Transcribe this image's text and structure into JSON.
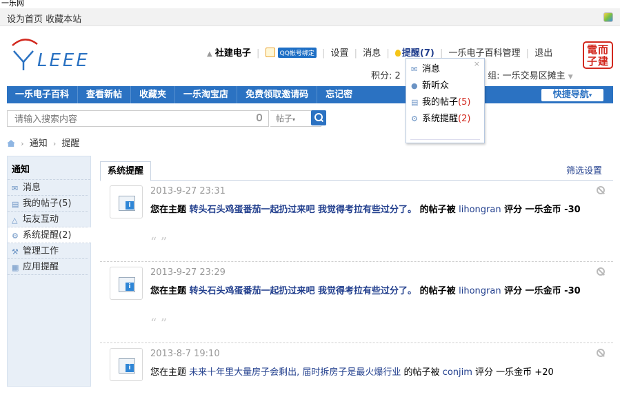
{
  "window": {
    "title": "一乐网"
  },
  "topbar": {
    "set_home": "设为首页",
    "bookmark": "收藏本站"
  },
  "user": {
    "name": "社建电子",
    "qq_bind": "QQ帐号绑定",
    "settings": "设置",
    "messages": "消息",
    "remind": "提醒(7)",
    "manage": "一乐电子百科管理",
    "logout": "退出",
    "score_label": "积分: 2",
    "group_label": "组: 一乐交易区摊主"
  },
  "seal": {
    "line1": "電而",
    "line2": "子建"
  },
  "nav": {
    "items": [
      "一乐电子百科",
      "查看新帖",
      "收藏夹",
      "一乐淘宝店",
      "免费领取邀请码",
      "忘记密"
    ],
    "quick": "快捷导航"
  },
  "search": {
    "placeholder": "请输入搜索内容",
    "type": "帖子"
  },
  "breadcrumb": {
    "items": [
      "通知",
      "提醒"
    ]
  },
  "sidebar": {
    "title": "通知",
    "items": [
      {
        "label": "消息",
        "icon": "envelope-icon"
      },
      {
        "label": "我的帖子(5)",
        "icon": "document-icon"
      },
      {
        "label": "坛友互动",
        "icon": "triangle-icon"
      },
      {
        "label": "系统提醒(2)",
        "icon": "gear-icon"
      },
      {
        "label": "管理工作",
        "icon": "wrench-icon"
      },
      {
        "label": "应用提醒",
        "icon": "grid-icon"
      }
    ]
  },
  "main": {
    "tab": "系统提醒",
    "filter": "筛选设置",
    "notices": [
      {
        "time": "2013-9-27 23:31",
        "prefix": "您在主题 ",
        "topic": "转头石头鸡蛋番茄一起扔过来吧 我觉得考拉有些过分了。",
        "mid": " 的帖子被 ",
        "user": "lihongran",
        "suffix": " 评分 一乐金币 -30"
      },
      {
        "time": "2013-9-27 23:29",
        "prefix": "您在主题 ",
        "topic": "转头石头鸡蛋番茄一起扔过来吧 我觉得考拉有些过分了。",
        "mid": " 的帖子被 ",
        "user": "lihongran",
        "suffix": " 评分 一乐金币 -30"
      },
      {
        "time": "2013-8-7 19:10",
        "prefix": "您在主题 ",
        "topic": "未来十年里大量房子会剩出, 届时拆房子是最火爆行业",
        "mid": " 的帖子被 ",
        "user": "conjim",
        "suffix": " 评分 一乐金币 +20"
      }
    ]
  },
  "dropdown": {
    "close": "×",
    "items": [
      {
        "label": "消息",
        "count": "",
        "icon": "envelope-icon"
      },
      {
        "label": "新听众",
        "count": "",
        "icon": "person-icon"
      },
      {
        "label": "我的帖子",
        "count": "(5)",
        "icon": "document-icon"
      },
      {
        "label": "系统提醒",
        "count": "(2)",
        "icon": "gear-icon"
      }
    ]
  }
}
